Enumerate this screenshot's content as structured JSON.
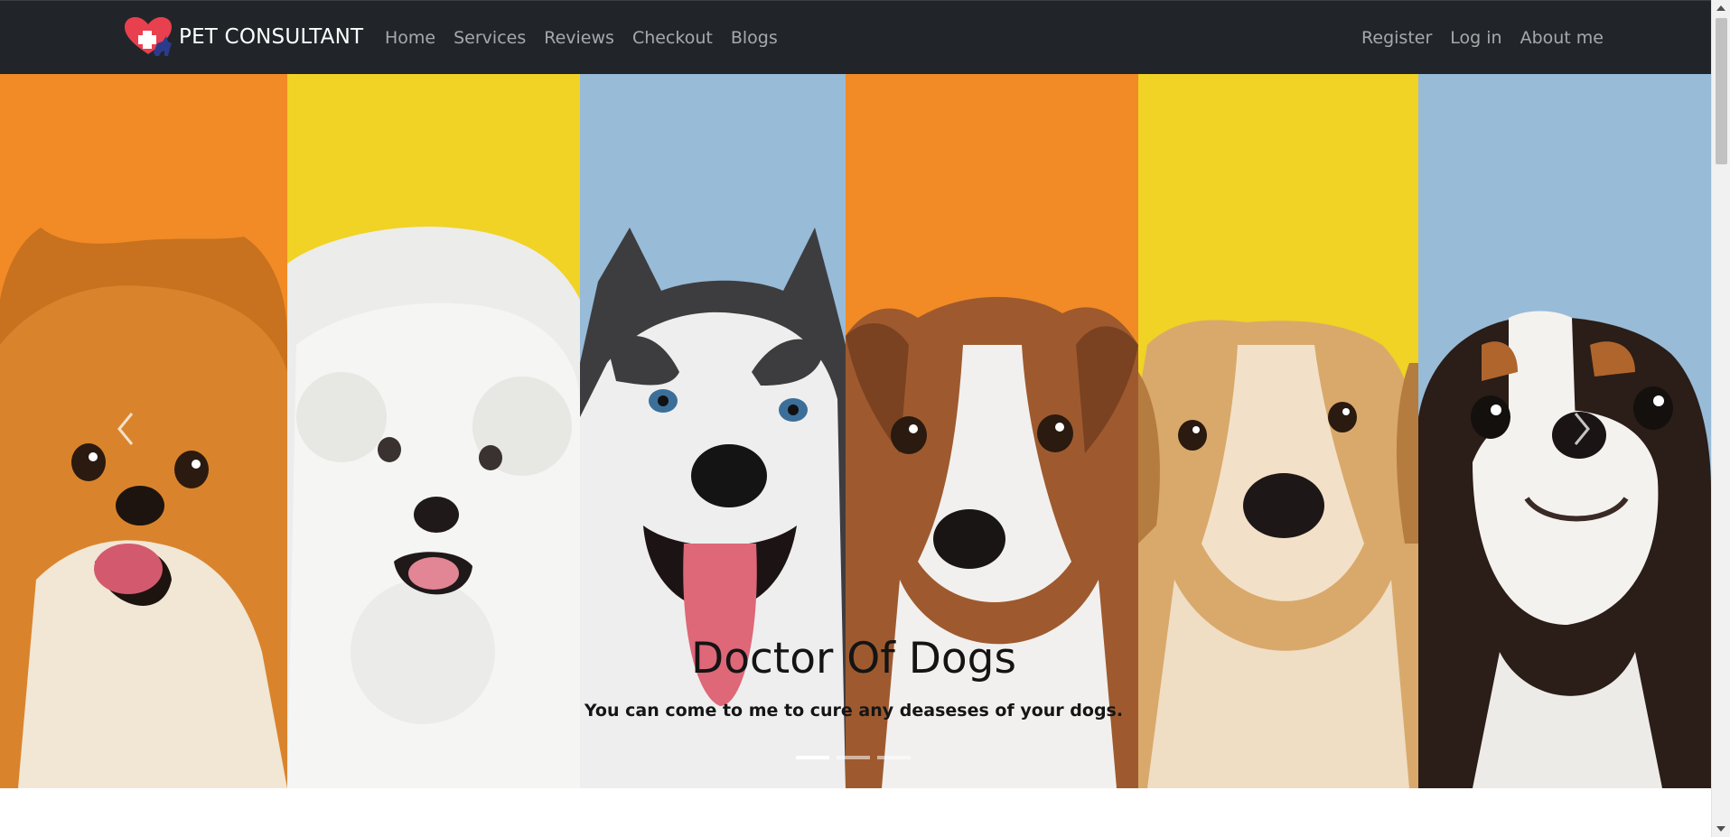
{
  "navbar": {
    "brand": "PET CONSULTANT",
    "links_left": [
      "Home",
      "Services",
      "Reviews",
      "Checkout",
      "Blogs"
    ],
    "links_right": [
      "Register",
      "Log in",
      "About me"
    ]
  },
  "hero": {
    "title": "Doctor Of Dogs",
    "text": "You can come to me to cure any deaseses of your dogs.",
    "indicators": 3,
    "active_indicator": 0,
    "prev_icon": "chevron-left-icon",
    "next_icon": "chevron-right-icon"
  },
  "colors": {
    "navbar_bg": "#212529",
    "orange": "#F28A26",
    "yellow": "#F0D325",
    "blue": "#98BBD8",
    "logo_red": "#E8404E",
    "logo_blue": "#2B3B8C"
  }
}
